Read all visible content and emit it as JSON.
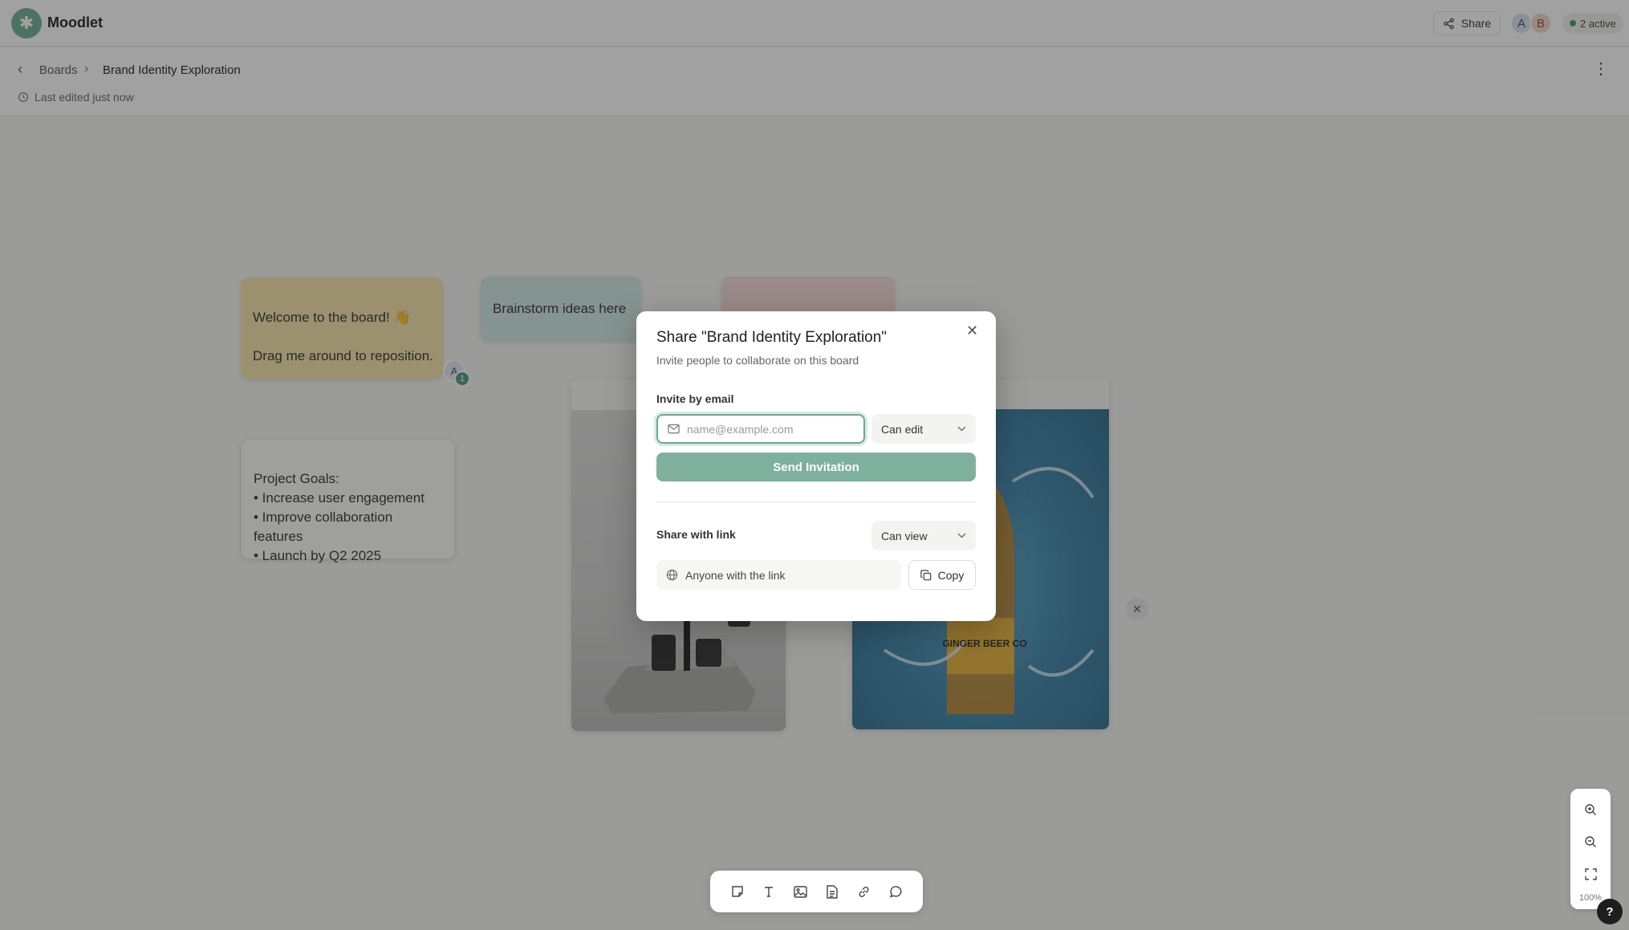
{
  "app": {
    "name": "Moodlet"
  },
  "topbar": {
    "share_label": "Share",
    "avatars": [
      "A",
      "B"
    ],
    "active_label": "2 active"
  },
  "breadcrumb": {
    "parent": "Boards",
    "current": "Brand Identity Exploration"
  },
  "status": {
    "last_edited": "Last edited just now"
  },
  "canvas": {
    "notes": {
      "welcome_line1": "Welcome to the board! 👋",
      "welcome_line2": "Drag me around to reposition.",
      "brainstorm": "Brainstorm ideas here",
      "goals": [
        "Project Goals:",
        "• Increase user engagement",
        "• Improve collaboration features",
        "• Launch by Q2 2025"
      ]
    },
    "cursor": {
      "initial": "A",
      "count": "1"
    },
    "image_label": "GINGER BEER CO"
  },
  "modal": {
    "title": "Share \"Brand Identity Exploration\"",
    "subtitle": "Invite people to collaborate on this board",
    "invite_label": "Invite by email",
    "email_placeholder": "name@example.com",
    "email_value": "",
    "invite_permission": "Can edit",
    "send_label": "Send Invitation",
    "link_label": "Share with link",
    "link_permission": "Can view",
    "link_scope": "Anyone with the link",
    "copy_label": "Copy"
  },
  "zoom": {
    "level": "100%"
  },
  "help": {
    "label": "?"
  },
  "colors": {
    "accent": "#6fae93",
    "send_button": "#7fb09d"
  }
}
